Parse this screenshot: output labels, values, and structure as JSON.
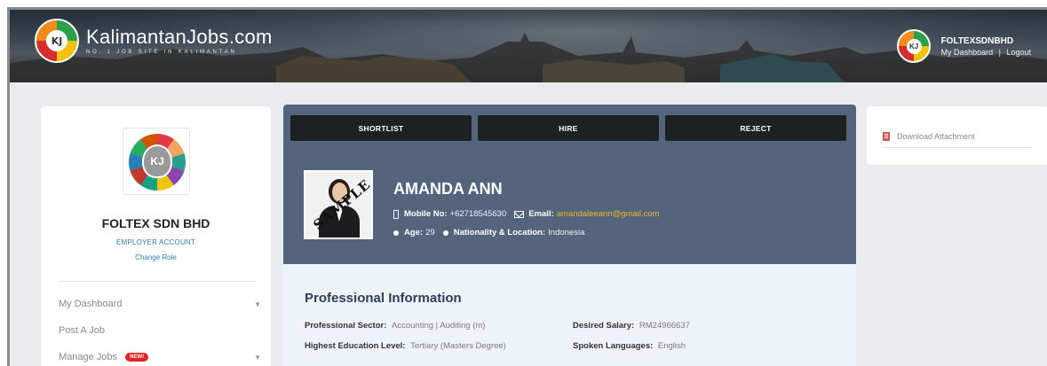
{
  "header": {
    "brand": "KalimantanJobs.com",
    "tagline": "NO. 1 JOB SITE IN KALIMANTAN",
    "logo_letters": "KJ",
    "user": {
      "name": "FOLTEXSDNBHD",
      "dashboard_link": "My Dashboard",
      "separator": "|",
      "logout_link": "Logout"
    }
  },
  "sidebar": {
    "logo_letters": "KJ",
    "company_name": "FOLTEX SDN BHD",
    "account_type": "EMPLOYER ACCOUNT",
    "change_role": "Change Role",
    "menu": [
      {
        "label": "My Dashboard",
        "has_caret": true
      },
      {
        "label": "Post A Job",
        "has_caret": false
      },
      {
        "label": "Manage Jobs",
        "has_caret": true,
        "badge": "NEW!"
      }
    ]
  },
  "candidate": {
    "actions": {
      "shortlist": "SHORTLIST",
      "hire": "HIRE",
      "reject": "REJECT"
    },
    "photo_watermark": "SAMPLE",
    "name": "AMANDA ANN",
    "mobile_label": "Mobile No:",
    "mobile_value": "+62718545630",
    "email_label": "Email:",
    "email_value": "amandaleeann@gmail.com",
    "age_label": "Age:",
    "age_value": "29",
    "nationality_label": "Nationality & Location:",
    "nationality_value": "Indonesia"
  },
  "professional": {
    "title": "Professional Information",
    "sector_label": "Professional Sector:",
    "sector_value": "Accounting | Auditing (m)",
    "salary_label": "Desired Salary:",
    "salary_value": "RM24966637",
    "education_label": "Highest Education Level:",
    "education_value": "Tertiary (Masters Degree)",
    "languages_label": "Spoken Languages:",
    "languages_value": "English"
  },
  "attachments": {
    "download_label": "Download Attachment"
  },
  "colors": {
    "profile_header": "#55647d",
    "action_button": "#1e2124",
    "email_accent": "#f0b429",
    "link_blue": "#2f7cc4",
    "badge_red": "#e02424",
    "section_title": "#2d3e5c"
  }
}
